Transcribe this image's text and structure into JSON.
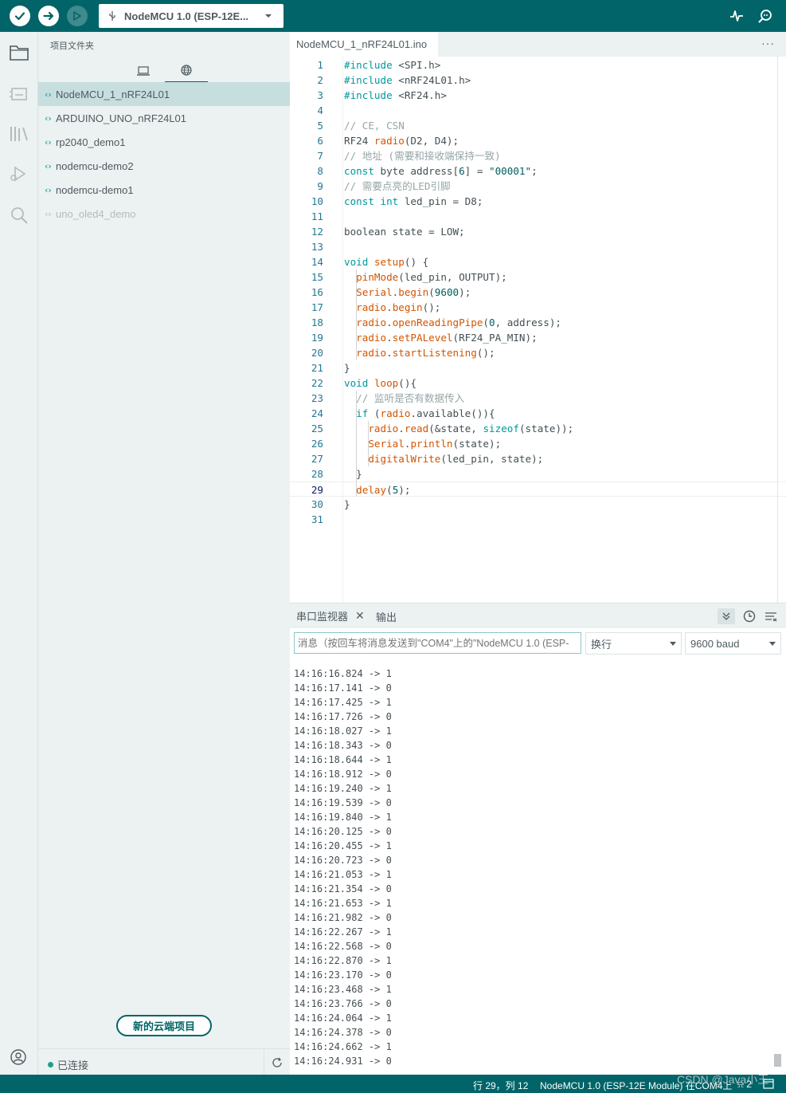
{
  "toolbar": {
    "board": "NodeMCU 1.0 (ESP-12E..."
  },
  "sidebar": {
    "title": "项目文件夹",
    "sketches": [
      "NodeMCU_1_nRF24L01",
      "ARDUINO_UNO_nRF24L01",
      "rp2040_demo1",
      "nodemcu-demo2",
      "nodemcu-demo1",
      "uno_oled4_demo"
    ],
    "new_cloud_button": "新的云端项目",
    "connection_status": "已连接"
  },
  "editor": {
    "tab": "NodeMCU_1_nRF24L01.ino",
    "more": "···",
    "current_line": 29,
    "lines": [
      "#include <SPI.h>",
      "#include <nRF24L01.h>",
      "#include <RF24.h>",
      "",
      "// CE, CSN",
      "RF24 radio(D2, D4);",
      "// 地址 (需要和接收端保持一致)",
      "const byte address[6] = \"00001\";",
      "// 需要点亮的LED引脚",
      "const int led_pin = D8;",
      "",
      "boolean state = LOW;",
      "",
      "void setup() {",
      "  pinMode(led_pin, OUTPUT);",
      "  Serial.begin(9600);",
      "  radio.begin();",
      "  radio.openReadingPipe(0, address);",
      "  radio.setPALevel(RF24_PA_MIN);",
      "  radio.startListening();",
      "}",
      "void loop(){",
      "  // 监听是否有数据传入",
      "  if (radio.available()){",
      "    radio.read(&state, sizeof(state));",
      "    Serial.println(state);",
      "    digitalWrite(led_pin, state);",
      "  }",
      "  delay(5);",
      "}",
      ""
    ]
  },
  "panel": {
    "tab_serial": "串口监视器",
    "tab_output": "输出",
    "message_placeholder": "消息（按回车将消息发送到\"COM4\"上的\"NodeMCU 1.0 (ESP-",
    "line_ending": "换行",
    "baud": "9600 baud",
    "output_lines": [
      "14:16:16.824 -> 1",
      "14:16:17.141 -> 0",
      "14:16:17.425 -> 1",
      "14:16:17.726 -> 0",
      "14:16:18.027 -> 1",
      "14:16:18.343 -> 0",
      "14:16:18.644 -> 1",
      "14:16:18.912 -> 0",
      "14:16:19.240 -> 1",
      "14:16:19.539 -> 0",
      "14:16:19.840 -> 1",
      "14:16:20.125 -> 0",
      "14:16:20.455 -> 1",
      "14:16:20.723 -> 0",
      "14:16:21.053 -> 1",
      "14:16:21.354 -> 0",
      "14:16:21.653 -> 1",
      "14:16:21.982 -> 0",
      "14:16:22.267 -> 1",
      "14:16:22.568 -> 0",
      "14:16:22.870 -> 1",
      "14:16:23.170 -> 0",
      "14:16:23.468 -> 1",
      "14:16:23.766 -> 0",
      "14:16:24.064 -> 1",
      "14:16:24.378 -> 0",
      "14:16:24.662 -> 1",
      "14:16:24.931 -> 0"
    ]
  },
  "status": {
    "position": "行 29，列 12",
    "board_port": "NodeMCU 1.0 (ESP-12E Module) 在COM4上",
    "notifications": "2"
  },
  "watermark": "CSDN @Java小王",
  "colors": {
    "brand_teal": "#006468",
    "accent": "#00979d",
    "function": "#d35400",
    "comment": "#95a5a6"
  }
}
